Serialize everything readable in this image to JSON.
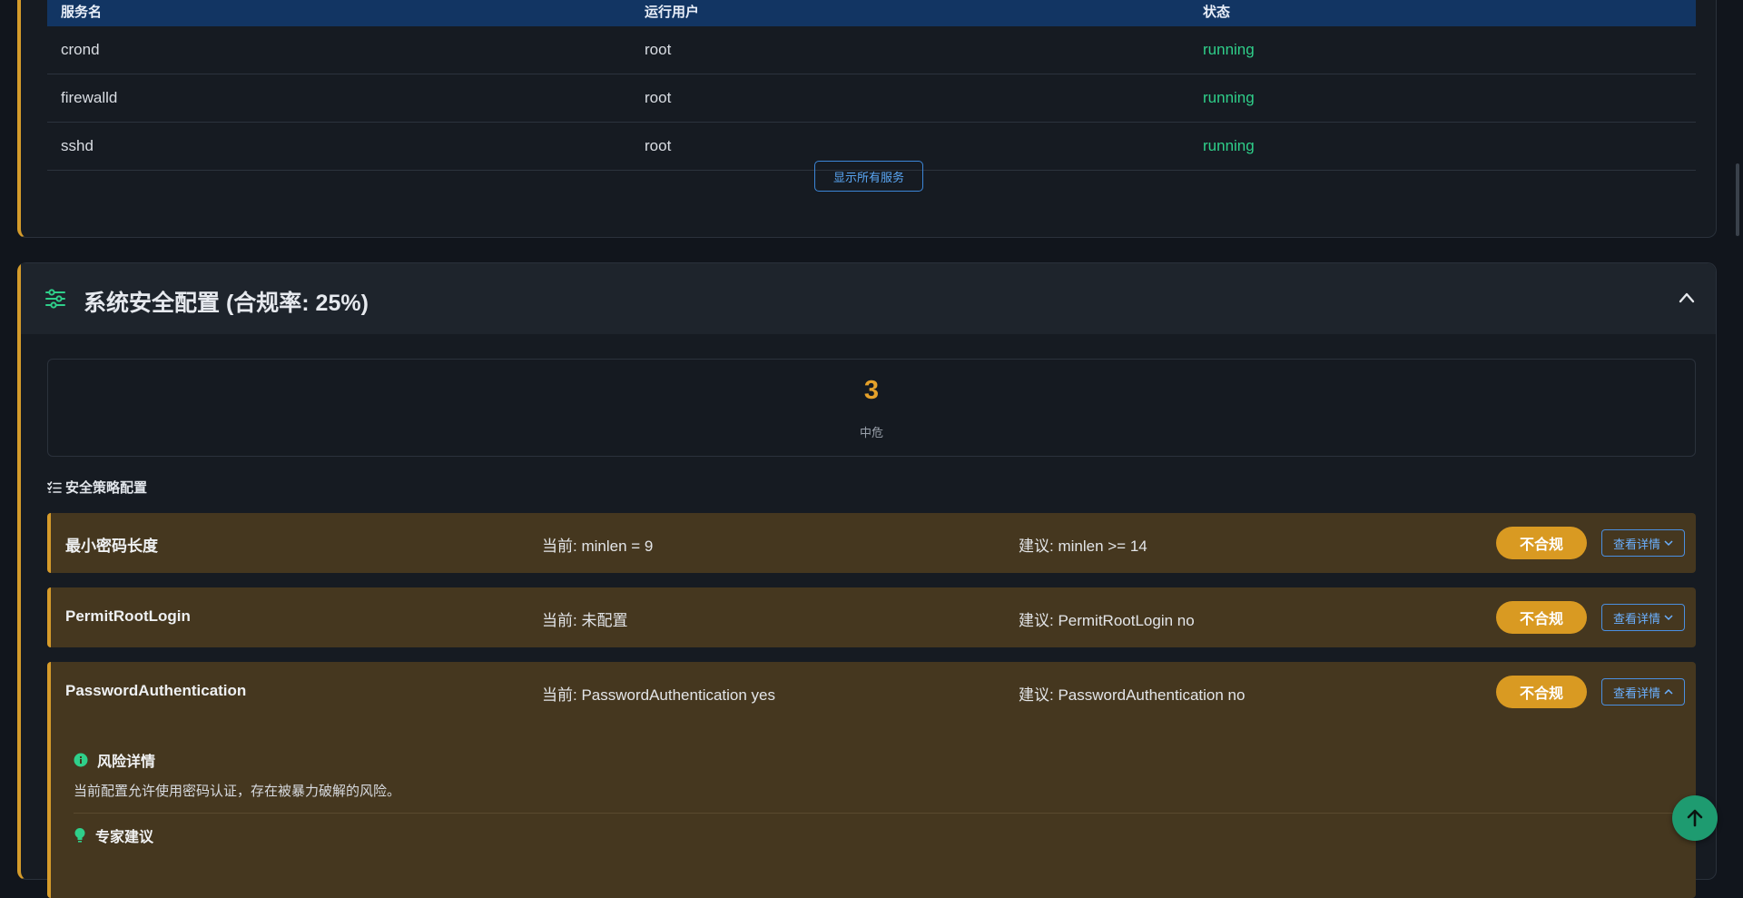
{
  "services": {
    "headers": [
      "服务名",
      "运行用户",
      "状态"
    ],
    "rows": [
      {
        "name": "crond",
        "user": "root",
        "status": "running"
      },
      {
        "name": "firewalld",
        "user": "root",
        "status": "running"
      },
      {
        "name": "sshd",
        "user": "root",
        "status": "running"
      }
    ],
    "show_all_label": "显示所有服务"
  },
  "config": {
    "title": "系统安全配置 (合规率: 25%)",
    "stat": {
      "value": "3",
      "label": "中危"
    },
    "policy_section_title": "安全策略配置",
    "policies": [
      {
        "name": "最小密码长度",
        "current": "当前: minlen = 9",
        "suggest": "建议: minlen >= 14",
        "badge": "不合规",
        "detail_label": "查看详情"
      },
      {
        "name": "PermitRootLogin",
        "current": "当前: 未配置",
        "suggest": "建议: PermitRootLogin no",
        "badge": "不合规",
        "detail_label": "查看详情"
      },
      {
        "name": "PasswordAuthentication",
        "current": "当前: PasswordAuthentication yes",
        "suggest": "建议: PasswordAuthentication no",
        "badge": "不合规",
        "detail_label": "查看详情"
      }
    ],
    "risk_detail": {
      "heading": "风险详情",
      "text": "当前配置允许使用密码认证，存在被暴力破解的风险。"
    },
    "expert_advice": {
      "heading": "专家建议"
    }
  },
  "colors": {
    "accent": "#d49b2b",
    "running": "#2fcf8a",
    "header_bg": "#123563",
    "badge": "#d99a22",
    "policy_bg": "#45371f"
  },
  "icons": [
    "sliders-icon",
    "chevron-up-icon",
    "list-check-icon",
    "chevron-down-icon",
    "info-icon",
    "lightbulb-icon",
    "arrow-up-icon"
  ]
}
